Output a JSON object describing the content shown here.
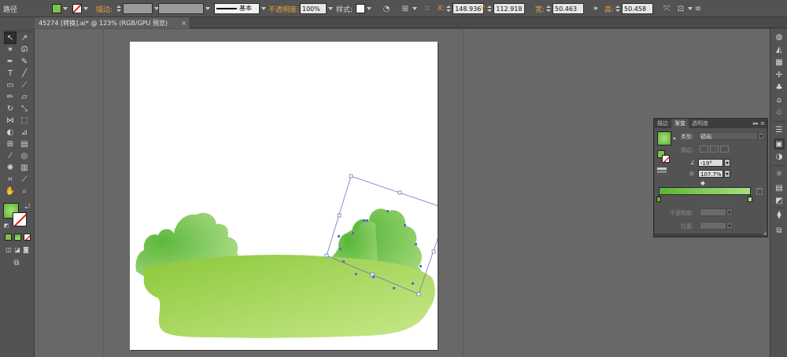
{
  "control_bar": {
    "object_type": "路径",
    "fill_color": "#7dc44a",
    "stroke_label": "描边:",
    "stroke_profile": "基本",
    "opacity_label": "不透明度:",
    "opacity_value": "100%",
    "style_label": "样式:",
    "x_label": "X:",
    "x_value": "148.936",
    "y_label": "Y:",
    "y_value": "112.918",
    "w_label": "宽:",
    "w_value": "50.463",
    "h_label": "高:",
    "h_value": "50.458"
  },
  "document": {
    "tab_title": "45274 [转换].ai* @ 123% (RGB/GPU 预览)",
    "close_glyph": "×"
  },
  "tools": {
    "fill_color": "#7dc44a",
    "icons": [
      "selection-tool-icon",
      "direct-selection-tool-icon",
      "magic-wand-icon",
      "lasso-icon",
      "pen-tool-icon",
      "curvature-tool-icon",
      "type-tool-icon",
      "line-tool-icon",
      "rectangle-tool-icon",
      "paintbrush-icon",
      "pencil-icon",
      "eraser-icon",
      "rotate-tool-icon",
      "scale-tool-icon",
      "width-tool-icon",
      "free-transform-icon",
      "shape-builder-icon",
      "perspective-grid-icon",
      "mesh-tool-icon",
      "gradient-tool-icon",
      "eyedropper-icon",
      "blend-tool-icon",
      "symbol-sprayer-icon",
      "column-graph-icon",
      "artboard-tool-icon",
      "slice-tool-icon",
      "hand-tool-icon",
      "zoom-tool-icon"
    ]
  },
  "gradient_panel": {
    "tabs": [
      "描边",
      "渐变",
      "透明度"
    ],
    "type_label": "类型:",
    "type_value": "径向",
    "stroke_label": "描边:",
    "angle_value": "-19°",
    "aspect_value": "107.7%",
    "opacity_label": "不透明度:",
    "position_label": "位置:",
    "start_color": "#5db236",
    "end_color": "#a8e27c"
  },
  "artwork": {
    "ground_gradient": [
      "#8cc83a",
      "#c8e88a"
    ],
    "bush_gradient": [
      "#5cb83c",
      "#b6e08e"
    ],
    "selection_color": "#5a6ec8"
  }
}
